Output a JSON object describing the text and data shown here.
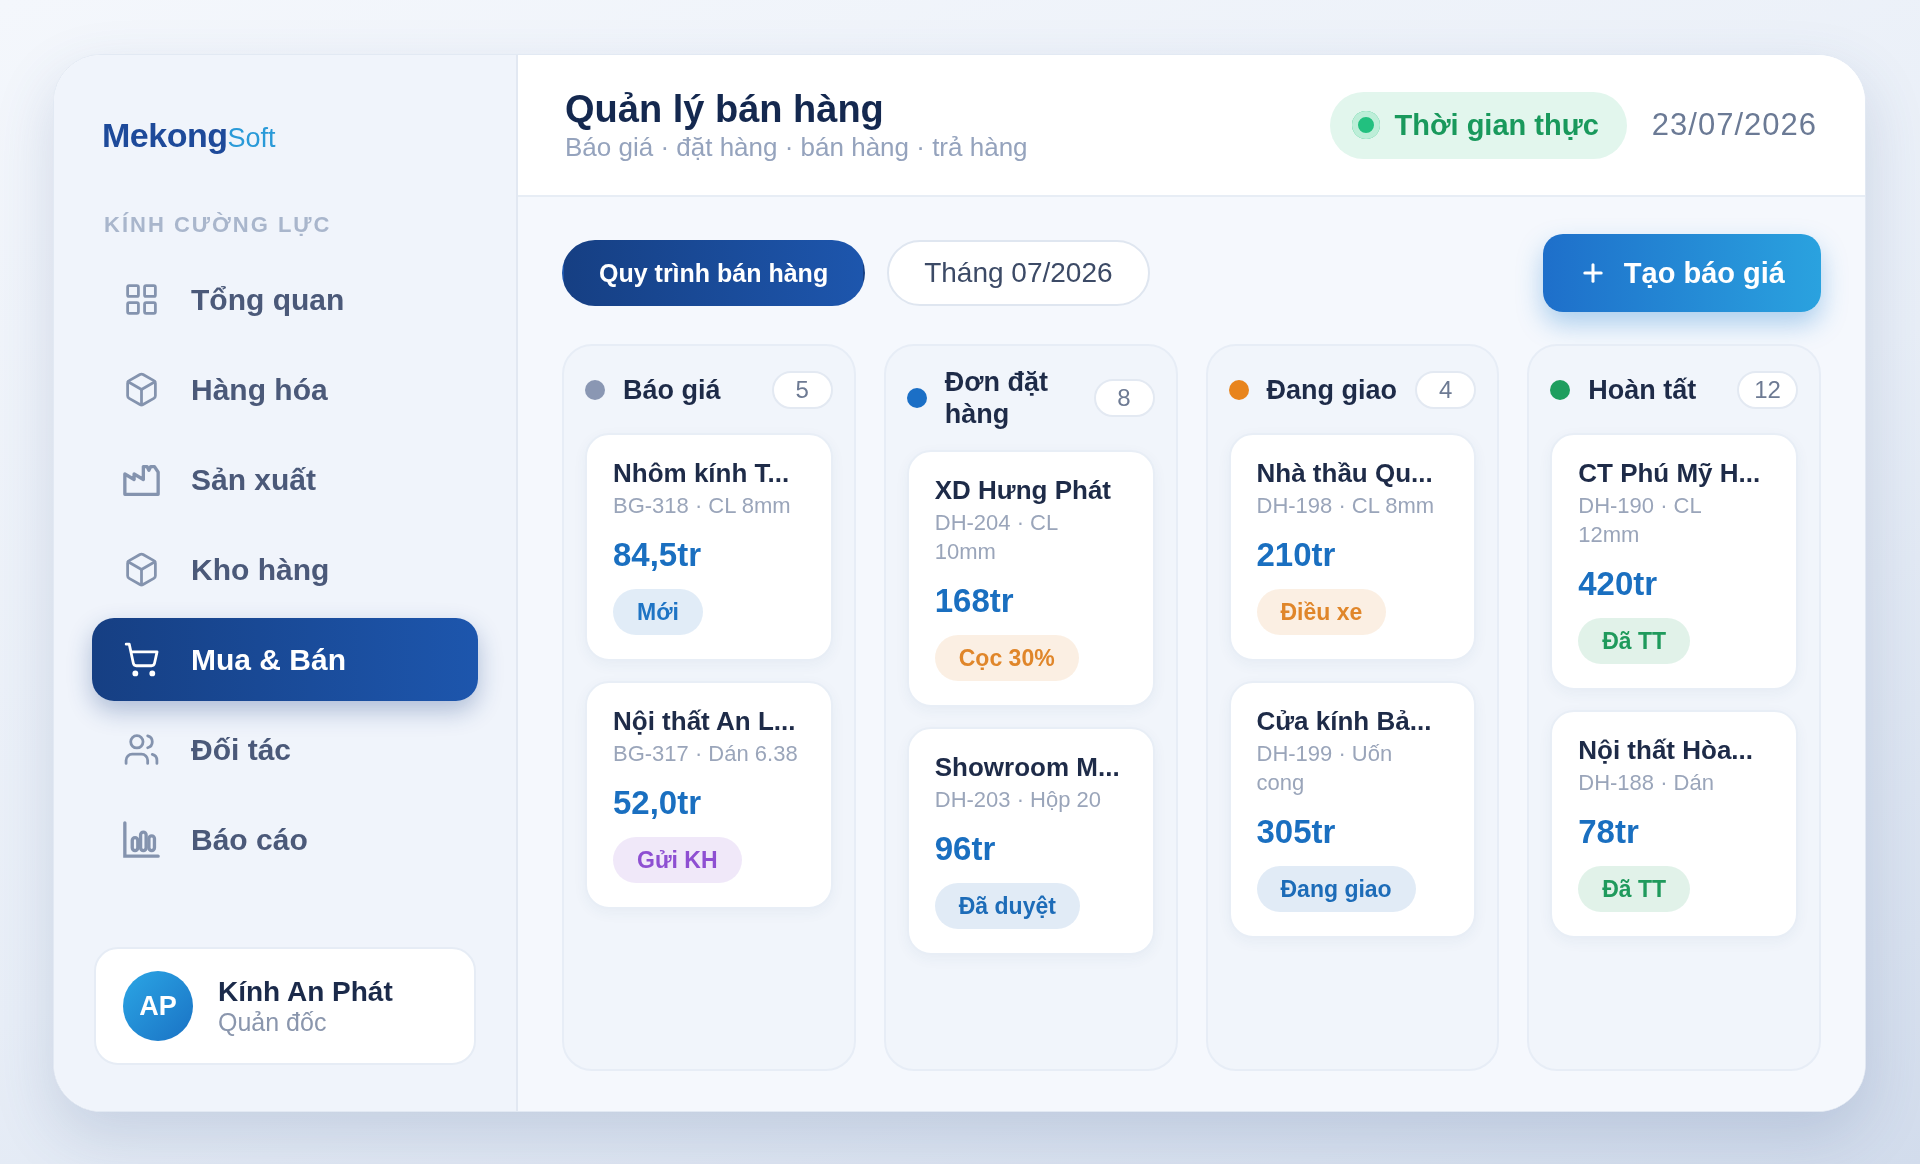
{
  "brand": {
    "name": "Mekong",
    "suffix": "Soft"
  },
  "sidebar": {
    "section_label": "KÍNH CƯỜNG LỰC",
    "items": [
      {
        "label": "Tổng quan",
        "selected": false
      },
      {
        "label": "Hàng hóa",
        "selected": false
      },
      {
        "label": "Sản xuất",
        "selected": false
      },
      {
        "label": "Kho hàng",
        "selected": false
      },
      {
        "label": "Mua & Bán",
        "selected": true
      },
      {
        "label": "Đối tác",
        "selected": false
      },
      {
        "label": "Báo cáo",
        "selected": false
      }
    ],
    "user": {
      "initials": "AP",
      "name": "Kính An Phát",
      "role": "Quản đốc"
    }
  },
  "header": {
    "title": "Quản lý bán hàng",
    "subtitle": "Báo giá · đặt hàng · bán hàng · trả hàng",
    "live_status": {
      "label": "Thời gian thực"
    },
    "date": "23/07/2026"
  },
  "toolbar": {
    "chips": [
      {
        "label": "Quy trình bán hàng",
        "selected": true
      },
      {
        "label": "Tháng 07/2026",
        "selected": false
      }
    ],
    "create_button": {
      "label": "Tạo báo giá"
    }
  },
  "board": {
    "columns": [
      {
        "title": "Báo giá",
        "count": "5",
        "color": "#8a97b3",
        "cards": [
          {
            "title": "Nhôm kính T...",
            "meta": "BG-318 · CL 8mm",
            "amount": "84,5tr",
            "status": {
              "label": "Mới",
              "color": "#1f74c4"
            }
          },
          {
            "title": "Nội thất An L...",
            "meta": "BG-317 · Dán 6.38",
            "amount": "52,0tr",
            "status": {
              "label": "Gửi KH",
              "color": "#8e4fd2"
            }
          }
        ]
      },
      {
        "title": "Đơn đặt hàng",
        "count": "8",
        "color": "#1b6fc6",
        "cards": [
          {
            "title": "XD Hưng Phát",
            "meta": "DH-204 · CL 10mm",
            "amount": "168tr",
            "status": {
              "label": "Cọc 30%",
              "color": "#e0862a"
            }
          },
          {
            "title": "Showroom M...",
            "meta": "DH-203 · Hộp 20",
            "amount": "96tr",
            "status": {
              "label": "Đã duyệt",
              "color": "#1d6cb8"
            }
          }
        ]
      },
      {
        "title": "Đang giao",
        "count": "4",
        "color": "#e8841c",
        "cards": [
          {
            "title": "Nhà thầu Qu...",
            "meta": "DH-198 · CL 8mm",
            "amount": "210tr",
            "status": {
              "label": "Điều xe",
              "color": "#e0862a"
            }
          },
          {
            "title": "Cửa kính Bả...",
            "meta": "DH-199 · Uốn cong",
            "amount": "305tr",
            "status": {
              "label": "Đang giao",
              "color": "#1d6cb8"
            }
          }
        ]
      },
      {
        "title": "Hoàn tất",
        "count": "12",
        "color": "#1e9e5e",
        "cards": [
          {
            "title": "CT Phú Mỹ H...",
            "meta": "DH-190 · CL 12mm",
            "amount": "420tr",
            "status": {
              "label": "Đã TT",
              "color": "#1f9a5c"
            }
          },
          {
            "title": "Nội thất Hòa...",
            "meta": "DH-188 · Dán",
            "amount": "78tr",
            "status": {
              "label": "Đã TT",
              "color": "#1f9a5c"
            }
          }
        ]
      }
    ]
  }
}
